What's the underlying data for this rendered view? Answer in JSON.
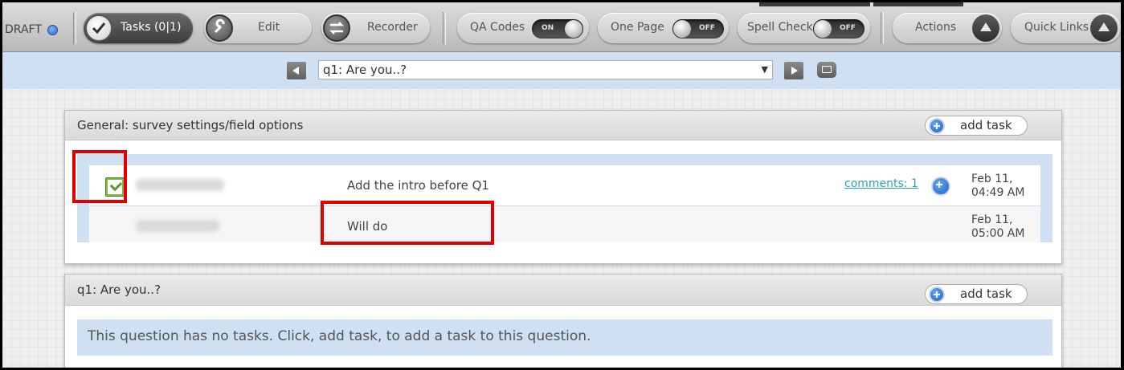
{
  "toolbar": {
    "draft_label": "DRAFT",
    "tasks_label": "Tasks (0|1)",
    "edit_label": "Edit",
    "recorder_label": "Recorder",
    "qa_codes": {
      "label": "QA Codes",
      "state": "ON"
    },
    "one_page": {
      "label": "One Page",
      "state": "OFF"
    },
    "spell_check": {
      "label": "Spell Check",
      "state": "OFF"
    },
    "actions_label": "Actions",
    "quick_links_label": "Quick Links"
  },
  "navigator": {
    "selected_question": "q1: Are you..?",
    "caret": "▼"
  },
  "panels": [
    {
      "title": "General: survey settings/field options",
      "add_task_label": "add task",
      "rows": [
        {
          "text": "Add the intro before Q1",
          "comments": "comments: 1",
          "date_line1": "Feb 11,",
          "date_line2": "04:49 AM"
        },
        {
          "text": "Will do",
          "date_line1": "Feb 11,",
          "date_line2": "05:00 AM"
        }
      ]
    },
    {
      "title": "q1: Are you..?",
      "add_task_label": "add task",
      "empty_message": "This question has no tasks. Click, add task, to add a task to this question."
    }
  ],
  "colors": {
    "highlight": "#e00000",
    "link": "#2aa6b5",
    "task_area": "#cfe0f2",
    "check": "#7fb843"
  }
}
